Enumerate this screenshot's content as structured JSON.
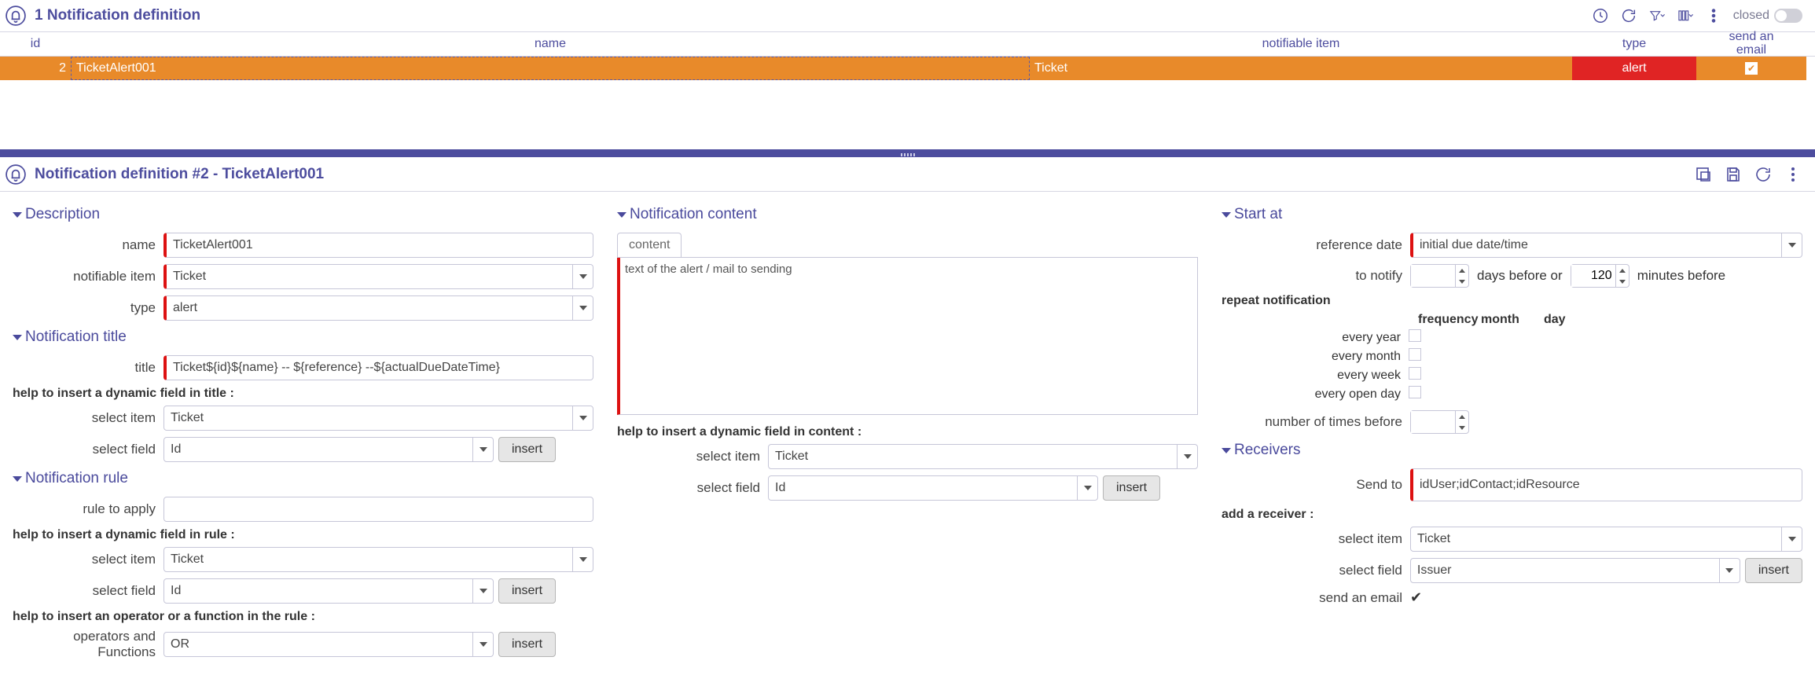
{
  "top": {
    "title": "1 Notification definition",
    "closed_label": "closed"
  },
  "table": {
    "headers": {
      "id": "id",
      "name": "name",
      "notifiable_item": "notifiable item",
      "type": "type",
      "send_email": "send an\nemail"
    },
    "row": {
      "id": "2",
      "name": "TicketAlert001",
      "notifiable_item": "Ticket",
      "type": "alert",
      "send_email": true
    }
  },
  "detail": {
    "title": "Notification definition  #2  - TicketAlert001"
  },
  "desc": {
    "section": "Description",
    "name_label": "name",
    "name_value": "TicketAlert001",
    "notifiable_label": "notifiable item",
    "notifiable_value": "Ticket",
    "type_label": "type",
    "type_value": "alert"
  },
  "ntitle": {
    "section": "Notification title",
    "title_label": "title",
    "title_value": "Ticket${id}${name} -- ${reference} --${actualDueDateTime}",
    "help": "help to insert a dynamic field in title :",
    "select_item_label": "select item",
    "select_item_value": "Ticket",
    "select_field_label": "select field",
    "select_field_value": "Id",
    "insert": "insert"
  },
  "rule": {
    "section": "Notification rule",
    "rule_label": "rule to apply",
    "rule_value": "",
    "help_field": "help to insert a dynamic field in rule :",
    "select_item_label": "select item",
    "select_item_value": "Ticket",
    "select_field_label": "select field",
    "select_field_value": "Id",
    "help_op": "help to insert an operator or a function in the rule :",
    "op_label": "operators and Functions",
    "op_value": "OR",
    "insert": "insert"
  },
  "content": {
    "section": "Notification content",
    "tab": "content",
    "text": "text of the alert / mail to sending",
    "help": "help to insert a dynamic field in content :",
    "select_item_label": "select item",
    "select_item_value": "Ticket",
    "select_field_label": "select field",
    "select_field_value": "Id",
    "insert": "insert"
  },
  "start": {
    "section": "Start at",
    "refdate_label": "reference date",
    "refdate_value": "initial due date/time",
    "notify_label": "to notify",
    "days_value": "",
    "days_after": "days before or",
    "minutes_value": "120",
    "minutes_after": "minutes before",
    "repeat_label": "repeat notification",
    "freq": "frequency",
    "month": "month",
    "day": "day",
    "every_year": "every year",
    "every_month": "every month",
    "every_week": "every week",
    "every_open_day": "every open day",
    "times_label": "number of times before",
    "times_value": ""
  },
  "recv": {
    "section": "Receivers",
    "sendto_label": "Send to",
    "sendto_value": "idUser;idContact;idResource",
    "add_label": "add a receiver :",
    "select_item_label": "select item",
    "select_item_value": "Ticket",
    "select_field_label": "select field",
    "select_field_value": "Issuer",
    "insert": "insert",
    "send_email_label": "send an email"
  }
}
